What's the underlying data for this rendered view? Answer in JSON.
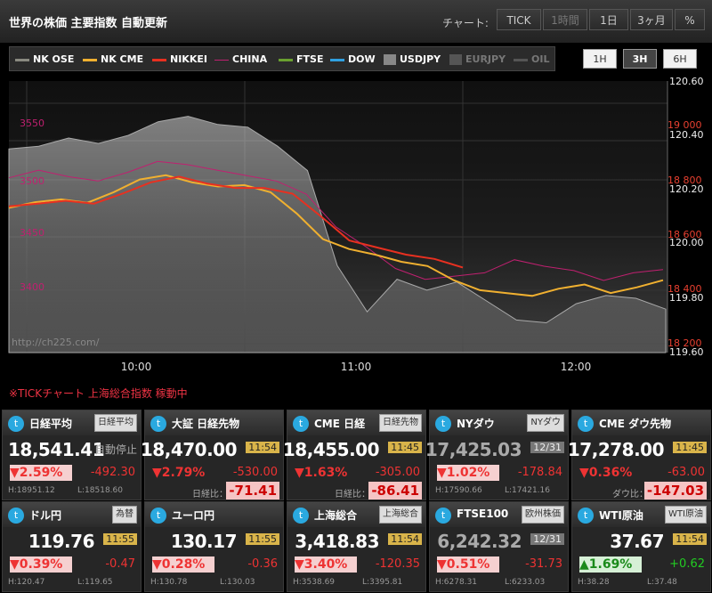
{
  "header": {
    "title": "世界の株価 主要指数 自動更新",
    "chart_label": "チャート:",
    "range_buttons": [
      "TICK",
      "1時間",
      "1日",
      "3ヶ月",
      "%"
    ]
  },
  "legend": [
    {
      "name": "NK OSE",
      "color": "#8a8a80",
      "dim": false
    },
    {
      "name": "NK CME",
      "color": "#f0b030",
      "dim": false
    },
    {
      "name": "NIKKEI",
      "color": "#e83020",
      "dim": false
    },
    {
      "name": "CHINA",
      "color": "#c02070",
      "dim": false
    },
    {
      "name": "FTSE",
      "color": "#6aa030",
      "dim": false
    },
    {
      "name": "DOW",
      "color": "#30a0e0",
      "dim": false
    },
    {
      "name": "USDJPY",
      "color": "#888888",
      "dim": false
    },
    {
      "name": "EURJPY",
      "color": "#555555",
      "dim": true
    },
    {
      "name": "OIL",
      "color": "#555555",
      "dim": true
    }
  ],
  "time_buttons": [
    "1H",
    "3H",
    "6H"
  ],
  "active_time": "3H",
  "chart_data": {
    "type": "line",
    "watermark": "http://ch225.com/",
    "x_ticks": [
      "10:00",
      "11:00",
      "12:00"
    ],
    "left_ticks": [
      "3550",
      "3500",
      "3450",
      "3400"
    ],
    "right_red_ticks": [
      "19 000",
      "18 800",
      "18 600",
      "18 400",
      "18 200"
    ],
    "right_white_ticks": [
      "120.60",
      "120.40",
      "120.20",
      "120.00",
      "119.80",
      "119.60"
    ],
    "series": [
      {
        "name": "NK CME",
        "unit": "JPY",
        "values": [
          18710,
          18730,
          18740,
          18728,
          18765,
          18810,
          18825,
          18800,
          18785,
          18790,
          18765,
          18690,
          18600,
          18565,
          18545,
          18520,
          18505,
          18455,
          18420,
          18410,
          18400,
          18425,
          18440,
          18410,
          18430,
          18455
        ]
      },
      {
        "name": "NIKKEI",
        "unit": "JPY",
        "values": [
          18715,
          18725,
          18735,
          18725,
          18760,
          18800,
          18820,
          18795,
          18780,
          18780,
          18760,
          18680,
          18595,
          18570,
          18545,
          18530,
          18500
        ]
      },
      {
        "name": "CHINA",
        "unit": "index",
        "values": [
          3503,
          3510,
          3504,
          3500,
          3508,
          3518,
          3515,
          3510,
          3505,
          3500,
          3488,
          3458,
          3440,
          3420,
          3410,
          3413,
          3416,
          3428,
          3422,
          3418,
          3409,
          3416,
          3419
        ]
      },
      {
        "name": "USDJPY",
        "unit": "JPY",
        "values": [
          120.35,
          120.36,
          120.39,
          120.37,
          120.4,
          120.45,
          120.47,
          120.44,
          120.43,
          120.36,
          120.27,
          119.92,
          119.75,
          119.87,
          119.83,
          119.86,
          119.79,
          119.72,
          119.71,
          119.78,
          119.81,
          119.8,
          119.76
        ]
      }
    ]
  },
  "notice": "※TICKチャート 上海総合指数 稼動中",
  "panels": [
    {
      "name": "日経平均",
      "link": "日経平均",
      "value": "18,541.41",
      "note": "自動停止",
      "pct": "▼2.59%",
      "pct_box": true,
      "pct_color": "red",
      "chg": "-492.30",
      "high": "H:18951.12",
      "low": "L:18518.60"
    },
    {
      "name": "大証 日経先物",
      "value": "18,470.00",
      "time": "11:54",
      "pct": "▼2.79%",
      "pct_box": false,
      "pct_color": "red",
      "chg": "-530.00",
      "diff_label": "日経比：",
      "diff": "-71.41"
    },
    {
      "name": "CME 日経",
      "link": "日経先物",
      "value": "18,455.00",
      "time": "11:45",
      "pct": "▼1.63%",
      "pct_box": false,
      "pct_color": "red",
      "chg": "-305.00",
      "diff_label": "日経比：",
      "diff": "-86.41"
    },
    {
      "name": "NYダウ",
      "link": "NYダウ",
      "value": "17,425.03",
      "value_dim": true,
      "time": "12/31",
      "time_gray": true,
      "pct": "▼1.02%",
      "pct_box": true,
      "pct_color": "red",
      "chg": "-178.84",
      "high": "H:17590.66",
      "low": "L:17421.16"
    },
    {
      "name": "CME ダウ先物",
      "value": "17,278.00",
      "time": "11:45",
      "pct": "▼0.36%",
      "pct_box": false,
      "pct_color": "red",
      "chg": "-63.00",
      "diff_label": "ダウ比：",
      "diff": "-147.03"
    },
    {
      "name": "ドル円",
      "link": "為替",
      "value": "119.76",
      "time": "11:55",
      "pct": "▼0.39%",
      "pct_box": true,
      "pct_color": "red",
      "chg": "-0.47",
      "high": "H:120.47",
      "low": "L:119.65"
    },
    {
      "name": "ユーロ円",
      "value": "130.17",
      "time": "11:55",
      "pct": "▼0.28%",
      "pct_box": true,
      "pct_color": "red",
      "chg": "-0.36",
      "high": "H:130.78",
      "low": "L:130.03"
    },
    {
      "name": "上海総合",
      "link": "上海総合",
      "value": "3,418.83",
      "time": "11:54",
      "pct": "▼3.40%",
      "pct_box": true,
      "pct_color": "red",
      "chg": "-120.35",
      "high": "H:3538.69",
      "low": "L:3395.81"
    },
    {
      "name": "FTSE100",
      "link": "欧州株価",
      "value": "6,242.32",
      "value_dim": true,
      "time": "12/31",
      "time_gray": true,
      "pct": "▼0.51%",
      "pct_box": true,
      "pct_color": "red",
      "chg": "-31.73",
      "high": "H:6278.31",
      "low": "L:6233.03"
    },
    {
      "name": "WTI原油",
      "link": "WTI原油",
      "value": "37.67",
      "time": "11:54",
      "pct": "▲1.69%",
      "pct_box": true,
      "pct_color": "green",
      "chg": "+0.62",
      "high": "H:38.28",
      "low": "L:37.48"
    }
  ]
}
